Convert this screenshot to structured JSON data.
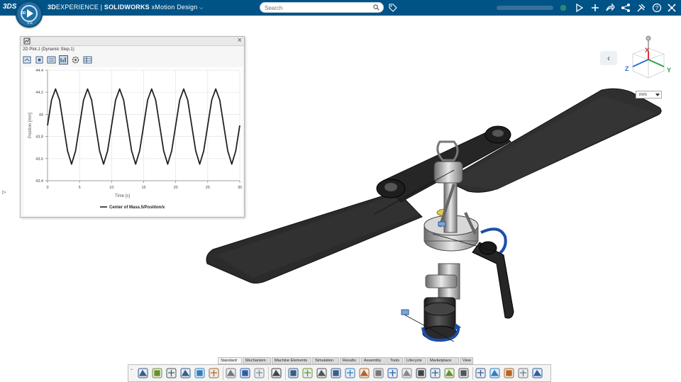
{
  "topbar": {
    "brand_logo": "3DS",
    "brand_prefix": "3D",
    "brand_experience": "EXPERIENCE",
    "brand_separator": " | ",
    "brand_product": "SOLIDWORKS",
    "brand_role": " xMotion Design",
    "compass_label": "3D",
    "compass_version": "V.R",
    "search_placeholder": "Search",
    "icons": [
      "share-icon",
      "add-icon",
      "share-network-icon",
      "tools-icon",
      "help-icon",
      "collaborate-icon"
    ]
  },
  "plot_panel": {
    "title": "2D Plot.1 (Dynamic Step.1)",
    "close_glyph": "×",
    "toolbar_icons": [
      "plot-export-icon",
      "fit-all-icon",
      "plot-settings-icon",
      "plot-graph-icon",
      "gear-icon",
      "table-icon"
    ]
  },
  "chart_data": {
    "type": "line",
    "xlabel": "Time [s]",
    "ylabel": "Position [mm]",
    "xlim": [
      0,
      30
    ],
    "ylim": [
      43.4,
      44.4
    ],
    "xticks": [
      0,
      5,
      10,
      15,
      20,
      25,
      30
    ],
    "xtick_labels": [
      "0",
      "5",
      "10",
      "15",
      "20",
      "25",
      "30"
    ],
    "yticks": [
      43.4,
      43.6,
      43.8,
      44.0,
      44.2,
      44.4
    ],
    "ytick_labels": [
      "43.4",
      "43.6",
      "43.8",
      "44",
      "44.2",
      "44.4"
    ],
    "grid": true,
    "legend_position": "bottom",
    "series": [
      {
        "name": "Center of Mass.5/Position/x",
        "color": "#222222",
        "x": [
          0,
          0.625,
          1.25,
          1.875,
          2.5,
          3.125,
          3.75,
          4.375,
          5,
          5.625,
          6.25,
          6.875,
          7.5,
          8.125,
          8.75,
          9.375,
          10,
          10.625,
          11.25,
          11.875,
          12.5,
          13.125,
          13.75,
          14.375,
          15,
          15.625,
          16.25,
          16.875,
          17.5,
          18.125,
          18.75,
          19.375,
          20,
          20.625,
          21.25,
          21.875,
          22.5,
          23.125,
          23.75,
          24.375,
          25,
          25.625,
          26.25,
          26.875,
          27.5,
          28.125,
          28.75,
          29.375,
          30
        ],
        "y": [
          43.9,
          44.13,
          44.23,
          44.13,
          43.9,
          43.67,
          43.55,
          43.67,
          43.9,
          44.13,
          44.23,
          44.13,
          43.9,
          43.67,
          43.55,
          43.67,
          43.9,
          44.13,
          44.23,
          44.13,
          43.9,
          43.67,
          43.55,
          43.67,
          43.9,
          44.13,
          44.23,
          44.13,
          43.9,
          43.67,
          43.55,
          43.67,
          43.9,
          44.13,
          44.23,
          44.13,
          43.9,
          43.67,
          43.55,
          43.67,
          43.9,
          44.13,
          44.23,
          44.13,
          43.9,
          43.67,
          43.55,
          43.67,
          43.9
        ]
      }
    ]
  },
  "compass_axes": {
    "x": "X",
    "y": "Y",
    "z": "Z",
    "x_color": "#e0302e",
    "y_color": "#2ea043",
    "z_color": "#2f6fd6"
  },
  "units": {
    "selected": "mm"
  },
  "nav": {
    "collapse_glyph": "‹",
    "left_handle_glyph": "⊳"
  },
  "tabs": [
    {
      "label": "Standard",
      "active": true
    },
    {
      "label": "Mechanism",
      "active": false
    },
    {
      "label": "Machine Elements",
      "active": false
    },
    {
      "label": "Simulation",
      "active": false
    },
    {
      "label": "Results",
      "active": false
    },
    {
      "label": "Assembly",
      "active": false
    },
    {
      "label": "Tools",
      "active": false
    },
    {
      "label": "Lifecycle",
      "active": false
    },
    {
      "label": "Marketplace",
      "active": false
    },
    {
      "label": "View",
      "active": false
    }
  ],
  "actionbar": {
    "expander_glyph": "⌄",
    "icons": [
      "data-icon",
      "new-icon",
      "save-icon",
      "save-local-icon",
      "refresh-icon",
      "copy-icon",
      "settings-icon",
      "undo-icon",
      "redo-icon",
      "help-icon",
      "assembly-icon",
      "fix-icon",
      "rigid-icon",
      "axis-icon",
      "joint-icon",
      "gear-joint-icon",
      "cam-icon",
      "spring-icon",
      "contact-icon",
      "motor-icon",
      "chart-icon",
      "sensor-icon",
      "simulate-icon",
      "trace-icon",
      "output-icon",
      "animate-icon",
      "play-icon",
      "record-icon"
    ]
  },
  "colors": {
    "topbar": "#005386",
    "accent_blue": "#1b4fa8",
    "blade": "#303030"
  }
}
